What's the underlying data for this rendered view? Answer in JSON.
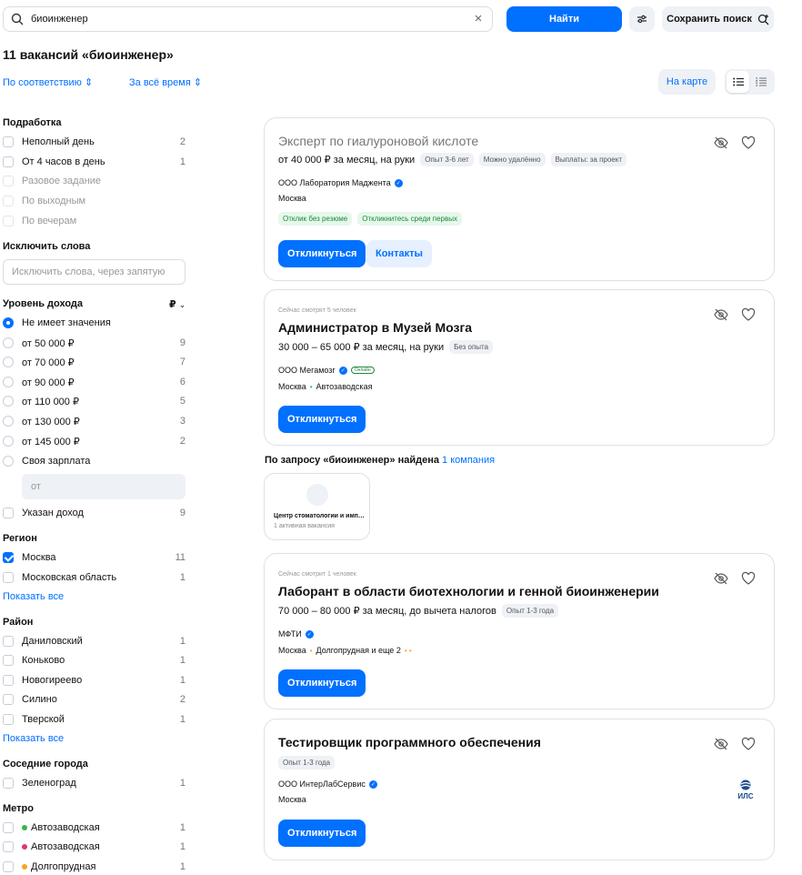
{
  "search": {
    "value": "биоинженер"
  },
  "buttons": {
    "find": "Найти",
    "save_search": "Сохранить поиск",
    "map": "На карте"
  },
  "title": "11 вакансий «биоинженер»",
  "sort": {
    "relevance": "По соответствию",
    "period": "За всё время"
  },
  "filters": {
    "side_job": {
      "heading": "Подработка",
      "items": [
        {
          "label": "Неполный день",
          "count": "2"
        },
        {
          "label": "От 4 часов в день",
          "count": "1"
        },
        {
          "label": "Разовое задание",
          "count": ""
        },
        {
          "label": "По выходным",
          "count": ""
        },
        {
          "label": "По вечерам",
          "count": ""
        }
      ]
    },
    "exclude": {
      "heading": "Исключить слова",
      "placeholder": "Исключить слова, через запятую"
    },
    "income": {
      "heading": "Уровень дохода",
      "currency": "₽",
      "items": [
        {
          "label": "Не имеет значения",
          "count": ""
        },
        {
          "label": "от 50 000 ₽",
          "count": "9"
        },
        {
          "label": "от 70 000 ₽",
          "count": "7"
        },
        {
          "label": "от 90 000 ₽",
          "count": "6"
        },
        {
          "label": "от 110 000 ₽",
          "count": "5"
        },
        {
          "label": "от 130 000 ₽",
          "count": "3"
        },
        {
          "label": "от 145 000 ₽",
          "count": "2"
        },
        {
          "label": "Своя зарплата",
          "count": ""
        }
      ],
      "from_placeholder": "от",
      "specified": {
        "label": "Указан доход",
        "count": "9"
      }
    },
    "region": {
      "heading": "Регион",
      "items": [
        {
          "label": "Москва",
          "count": "11"
        },
        {
          "label": "Московская область",
          "count": "1"
        }
      ],
      "show_all": "Показать все"
    },
    "district": {
      "heading": "Район",
      "items": [
        {
          "label": "Даниловский",
          "count": "1"
        },
        {
          "label": "Коньково",
          "count": "1"
        },
        {
          "label": "Новогиреево",
          "count": "1"
        },
        {
          "label": "Силино",
          "count": "2"
        },
        {
          "label": "Тверской",
          "count": "1"
        }
      ],
      "show_all": "Показать все"
    },
    "nearby": {
      "heading": "Соседние города",
      "items": [
        {
          "label": "Зеленоград",
          "count": "1"
        }
      ]
    },
    "metro": {
      "heading": "Метро",
      "items": [
        {
          "label": "Автозаводская",
          "count": "1",
          "color": "#3bb44a"
        },
        {
          "label": "Автозаводская",
          "count": "1",
          "color": "#d93a6b"
        },
        {
          "label": "Долгопрудная",
          "count": "1",
          "color": "#f5a623"
        }
      ]
    }
  },
  "vacancies": [
    {
      "title": "Эксперт по гиалуроновой кислоте",
      "salary": "от 40 000 ₽ за месяц, на руки",
      "tags": [
        "Опыт 3-6 лет",
        "Можно удалённо",
        "Выплаты: за проект"
      ],
      "company": "ООО Лаборатория Маджента",
      "city": "Москва",
      "badges": [
        "Отклик без резюме",
        "Откликнитесь среди первых"
      ],
      "apply": "Откликнуться",
      "contacts": "Контакты"
    },
    {
      "watching": "Сейчас смотрят 5 человек",
      "title": "Администратор в Музей Мозга",
      "salary": "30 000 – 65 000 ₽ за месяц, на руки",
      "tags": [
        "Без опыта"
      ],
      "company": "ООО Мегамозг",
      "online": "Онлайн",
      "city": "Москва",
      "metro": "Автозаводская",
      "apply": "Откликнуться"
    },
    {
      "watching": "Сейчас смотрит 1 человек",
      "title": "Лаборант в области биотехнологии и генной биоинженерии",
      "salary": "70 000 – 80 000 ₽ за месяц, до вычета налогов",
      "tags": [
        "Опыт 1-3 года"
      ],
      "company": "МФТИ",
      "city": "Москва",
      "metro": "Долгопрудная и еще 2",
      "apply": "Откликнуться"
    },
    {
      "title": "Тестировщик программного обеспечения",
      "tags": [
        "Опыт 1-3 года"
      ],
      "company": "ООО ИнтерЛабСервис",
      "city": "Москва",
      "logo_text": "ИЛС",
      "apply": "Откликнуться"
    }
  ],
  "company_search": {
    "prefix": "По запросу «биоинженер» найдена",
    "link": "1 компания",
    "card": {
      "name": "Центр стоматологии и имплантации",
      "vacancies": "1 активная вакансия"
    }
  },
  "colors": {
    "accent": "#0070ff",
    "green": "#1a8a3a"
  }
}
